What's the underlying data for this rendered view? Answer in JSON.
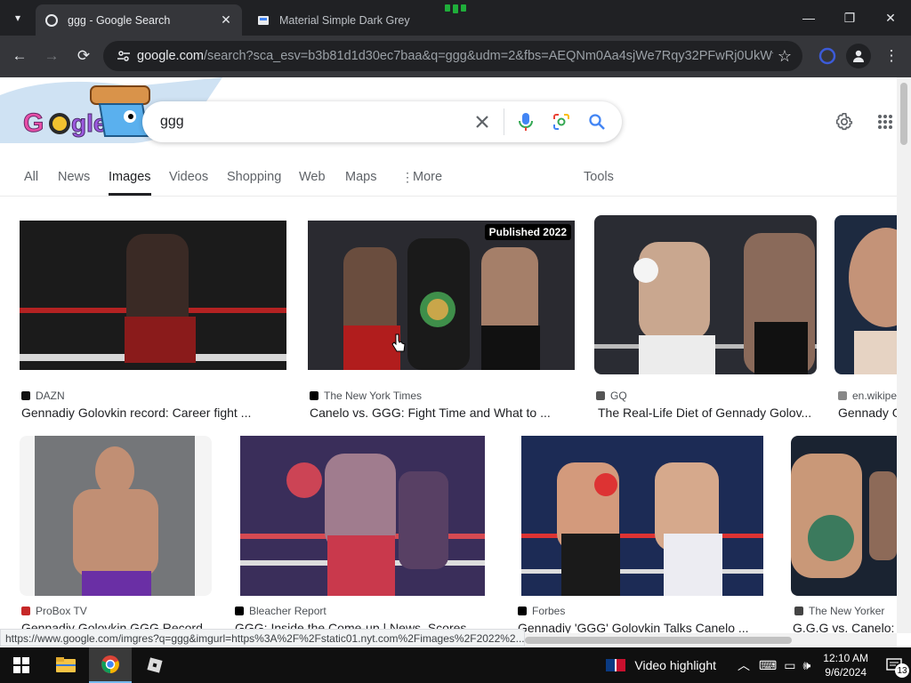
{
  "browser": {
    "tabs": [
      {
        "title": "ggg - Google Search",
        "active": true
      },
      {
        "title": "Material Simple Dark Grey",
        "active": false
      }
    ],
    "url_domain": "google.com",
    "url_path": "/search?sca_esv=b3b81d1d30ec7baa&q=ggg&udm=2&fbs=AEQNm0Aa4sjWe7Rqy32PFwRj0UkWt...",
    "status_url": "https://www.google.com/imgres?q=ggg&imgurl=https%3A%2F%2Fstatic01.nyt.com%2Fimages%2F2022%2..."
  },
  "search": {
    "query": "ggg",
    "nav": [
      "All",
      "News",
      "Images",
      "Videos",
      "Shopping",
      "Web",
      "Maps",
      "More"
    ],
    "active_nav": "Images",
    "tools_label": "Tools"
  },
  "results_row1": [
    {
      "source": "DAZN",
      "caption": "Gennadiy Golovkin record: Career fight ...",
      "src_color": "#111111",
      "palette": [
        "#1b1b1b",
        "#3a2a25",
        "#8a1b1b"
      ]
    },
    {
      "source": "The New York Times",
      "caption": "Canelo vs. GGG: Fight Time and What to ...",
      "badge": "Published 2022",
      "src_color": "#000000",
      "palette": [
        "#2a2a30",
        "#6a4d3e",
        "#b11d1d"
      ]
    },
    {
      "source": "GQ",
      "caption": "The Real-Life Diet of Gennady Golov...",
      "src_color": "#555555",
      "palette": [
        "#2a2c33",
        "#c9a78f",
        "#ececec"
      ]
    },
    {
      "source": "en.wikipe",
      "caption": "Gennady G",
      "src_color": "#888888",
      "palette": [
        "#1d2a40",
        "#c49378",
        "#e6d3c3"
      ]
    }
  ],
  "results_row2": [
    {
      "source": "ProBox TV",
      "caption": "Gennadiy Golovkin GGG Record ...",
      "src_color": "#c62828",
      "palette": [
        "#747679",
        "#c18f74",
        "#6a2fa5"
      ]
    },
    {
      "source": "Bleacher Report",
      "caption": "GGG: Inside the Come-up | News, Scores ...",
      "src_color": "#000000",
      "palette": [
        "#3a2e5a",
        "#a07c8e",
        "#c9394c"
      ]
    },
    {
      "source": "Forbes",
      "caption": "Gennadiy 'GGG' Golovkin Talks Canelo ...",
      "src_color": "#000000",
      "palette": [
        "#1c2b55",
        "#d39a7c",
        "#ececf2"
      ]
    },
    {
      "source": "The New Yorker",
      "caption": "G.G.G vs. Canelo: ...",
      "src_color": "#444444",
      "palette": [
        "#1a2331",
        "#c99878",
        "#3b7a5d"
      ]
    }
  ],
  "taskbar": {
    "notification_text": "Video highlight",
    "time": "12:10 AM",
    "date": "9/6/2024",
    "notification_count": "13"
  }
}
